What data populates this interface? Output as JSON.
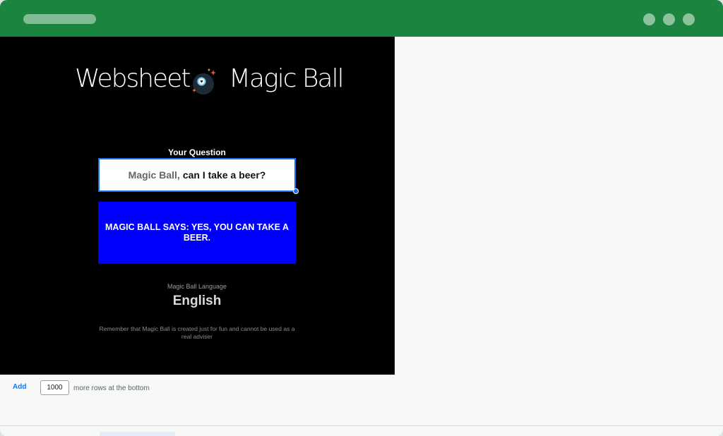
{
  "brand": {
    "left_word": "Websheet",
    "right_word": "Magic Ball",
    "icon": "magic-8-ball-icon"
  },
  "question": {
    "label": "Your Question",
    "prefix": "Magic Ball,",
    "text": "can I take a beer?"
  },
  "answer": {
    "text": "MAGIC BALL SAYS: YES, YOU CAN TAKE A BEER."
  },
  "language": {
    "label": "Magic Ball Language",
    "value": "English"
  },
  "disclaimer": "Remember that Magic Ball is created just for fun and cannot be used as a real adviser",
  "sheet_footer": {
    "add_label": "Add",
    "rows_value": "1000",
    "more_rows_text": "more rows at the bottom"
  },
  "colors": {
    "titlebar": "#1b843e",
    "panel_bg": "#000000",
    "answer_bg": "#0000ff",
    "accent": "#1a73e8"
  }
}
